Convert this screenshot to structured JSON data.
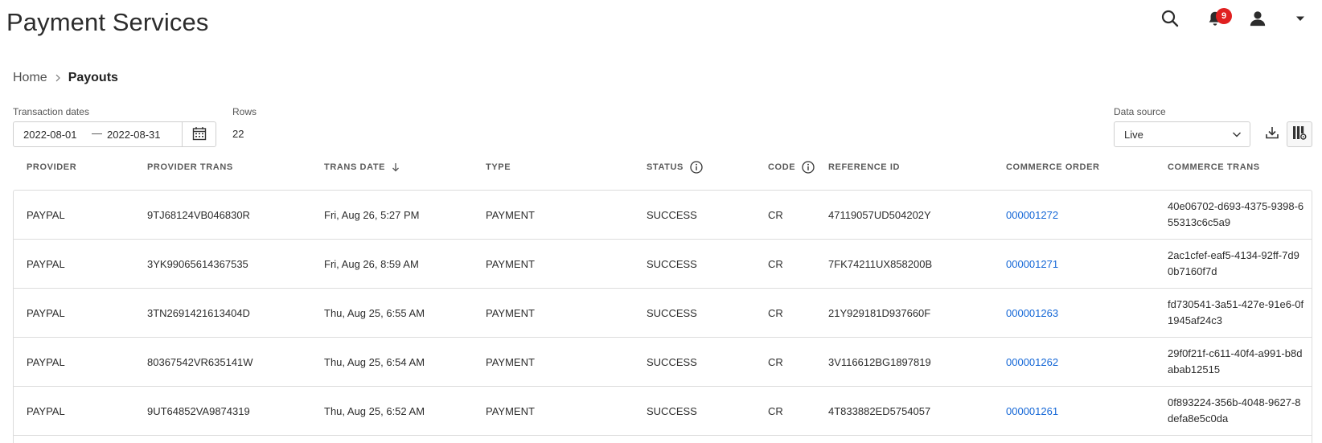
{
  "page": {
    "title": "Payment Services"
  },
  "header": {
    "notifications_count": "9"
  },
  "breadcrumb": {
    "home": "Home",
    "current": "Payouts"
  },
  "filters": {
    "dates_label": "Transaction dates",
    "date_from": "2022-08-01",
    "date_separator": "—",
    "date_to": "2022-08-31",
    "rows_label": "Rows",
    "rows_value": "22",
    "source_label": "Data source",
    "source_value": "Live"
  },
  "table": {
    "headers": [
      "PROVIDER",
      "PROVIDER TRANS",
      "TRANS DATE",
      "TYPE",
      "STATUS",
      "CODE",
      "REFERENCE ID",
      "COMMERCE ORDER",
      "COMMERCE TRANS"
    ],
    "sort": {
      "column": "TRANS DATE",
      "direction": "descending"
    },
    "rows": [
      {
        "provider": "PAYPAL",
        "provider_trans": "9TJ68124VB046830R",
        "trans_date": "Fri, Aug 26, 5:27 PM",
        "type": "PAYMENT",
        "status": "SUCCESS",
        "code": "CR",
        "reference_id": "47119057UD504202Y",
        "commerce_order": "000001272",
        "commerce_trans": "40e06702-d693-4375-9398-655313c6c5a9"
      },
      {
        "provider": "PAYPAL",
        "provider_trans": "3YK99065614367535",
        "trans_date": "Fri, Aug 26, 8:59 AM",
        "type": "PAYMENT",
        "status": "SUCCESS",
        "code": "CR",
        "reference_id": "7FK74211UX858200B",
        "commerce_order": "000001271",
        "commerce_trans": "2ac1cfef-eaf5-4134-92ff-7d90b7160f7d"
      },
      {
        "provider": "PAYPAL",
        "provider_trans": "3TN2691421613404D",
        "trans_date": "Thu, Aug 25, 6:55 AM",
        "type": "PAYMENT",
        "status": "SUCCESS",
        "code": "CR",
        "reference_id": "21Y929181D937660F",
        "commerce_order": "000001263",
        "commerce_trans": "fd730541-3a51-427e-91e6-0f1945af24c3"
      },
      {
        "provider": "PAYPAL",
        "provider_trans": "80367542VR635141W",
        "trans_date": "Thu, Aug 25, 6:54 AM",
        "type": "PAYMENT",
        "status": "SUCCESS",
        "code": "CR",
        "reference_id": "3V116612BG1897819",
        "commerce_order": "000001262",
        "commerce_trans": "29f0f21f-c611-40f4-a991-b8dabab12515"
      },
      {
        "provider": "PAYPAL",
        "provider_trans": "9UT64852VA9874319",
        "trans_date": "Thu, Aug 25, 6:52 AM",
        "type": "PAYMENT",
        "status": "SUCCESS",
        "code": "CR",
        "reference_id": "4T833882ED5754057",
        "commerce_order": "000001261",
        "commerce_trans": "0f893224-356b-4048-9627-8defa8e5c0da"
      }
    ]
  },
  "colors": {
    "link": "#1366d6",
    "badge": "#e02020",
    "border": "#dcdcdc"
  },
  "icons": [
    "search-icon",
    "bell-icon",
    "user-icon",
    "caret-down-icon",
    "chevron-right-icon",
    "calendar-icon",
    "chevron-down-icon",
    "download-icon",
    "columns-icon",
    "info-icon",
    "sort-arrow-down-icon"
  ]
}
